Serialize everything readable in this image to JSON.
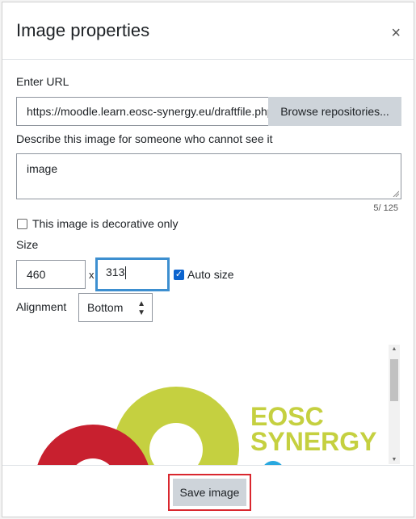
{
  "dialog": {
    "title": "Image properties",
    "close_glyph": "×",
    "url_label": "Enter URL",
    "url_value": "https://moodle.learn.eosc-synergy.eu/draftfile.php",
    "browse_label": "Browse repositories...",
    "alt_label": "Describe this image for someone who cannot see it",
    "alt_value": "image",
    "alt_counter": "5/ 125",
    "decorative_label": "This image is decorative only",
    "decorative_checked": false,
    "size_label": "Size",
    "width_value": "460",
    "times_glyph": "x",
    "height_value": "313",
    "autosize_label": "Auto size",
    "autosize_checked": true,
    "alignment_label": "Alignment",
    "alignment_value": "Bottom",
    "preview_logo_text": [
      "EOSC",
      "SYNERGY"
    ],
    "save_label": "Save image"
  },
  "colors": {
    "logo_green": "#c5d040",
    "logo_red": "#c8202f",
    "logo_blue": "#29a8df",
    "highlight_red": "#d9272e",
    "focus_blue": "#3d8fd0"
  }
}
